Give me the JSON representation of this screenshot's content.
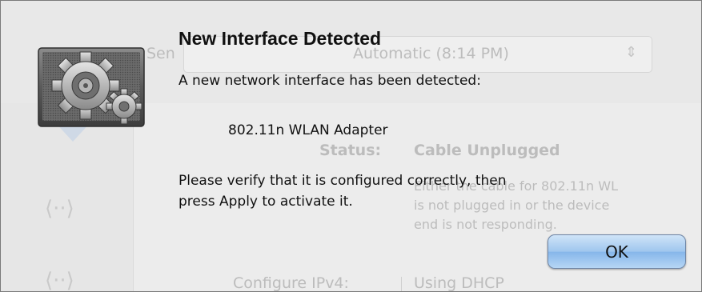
{
  "background_window": {
    "popup_label_fragment": "Sen",
    "popup_value": "Automatic (8:14 PM)",
    "status_label": "Status:",
    "status_value": "Cable Unplugged",
    "status_detail_line1": "Either the cable for 802.11n WL",
    "status_detail_line2": "is not plugged in or the device",
    "status_detail_line3": "end is not responding.",
    "configure_label": "Configure IPv4:",
    "configure_value": "Using DHCP"
  },
  "alert": {
    "icon": "gears-icon",
    "title": "New Interface Detected",
    "message_line1": "A new network interface has been detected:",
    "interface_name": "802.11n WLAN Adapter",
    "instruction_line1": "Please verify that it is configured correctly, then",
    "instruction_line2": "press Apply to activate it.",
    "ok_label": "OK"
  },
  "colors": {
    "button_blue": "#9fc6ee",
    "background_gray": "#ececec"
  }
}
